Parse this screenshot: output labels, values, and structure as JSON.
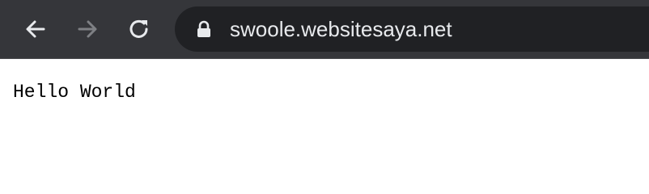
{
  "browser": {
    "toolbar_color": "#35363a",
    "omnibox_color": "#202124",
    "buttons": {
      "back": {
        "icon": "back-arrow-icon",
        "enabled": true
      },
      "forward": {
        "icon": "forward-arrow-icon",
        "enabled": false
      },
      "reload": {
        "icon": "reload-icon",
        "enabled": true
      }
    },
    "address_bar": {
      "secure_icon": "lock-icon",
      "url": "swoole.websitesaya.net"
    }
  },
  "page": {
    "body_text": "Hello World"
  }
}
